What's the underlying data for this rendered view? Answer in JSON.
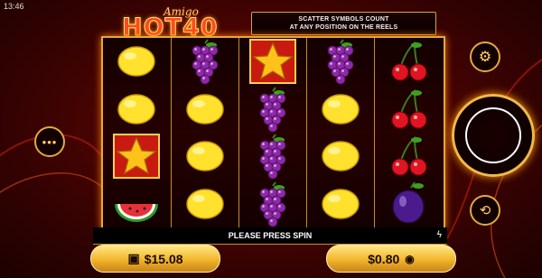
{
  "status": {
    "time": "13:46"
  },
  "logo": {
    "sub": "Amigo",
    "main": "HOT40"
  },
  "banner": {
    "line1": "SCATTER SYMBOLS COUNT",
    "line2": "AT ANY POSITION ON THE REELS"
  },
  "reels": [
    [
      "lemon",
      "lemon",
      "star",
      "watermelon"
    ],
    [
      "grapes",
      "lemon",
      "lemon",
      "lemon"
    ],
    [
      "star",
      "grapes",
      "grapes",
      "grapes"
    ],
    [
      "grapes",
      "lemon",
      "lemon",
      "lemon"
    ],
    [
      "cherries",
      "cherries",
      "cherries",
      "plum"
    ]
  ],
  "message": "PLEASE PRESS SPIN",
  "balance": {
    "value": "$15.08",
    "icon": "wallet-icon"
  },
  "bet": {
    "value": "$0.80",
    "icon": "coins-icon"
  },
  "buttons": {
    "settings_icon": "gear-icon",
    "menu_icon": "more-icon",
    "spin_icon": "spin-icon",
    "autoplay_icon": "autoplay-icon"
  },
  "colors": {
    "gold": "#e3a93c",
    "background": "#3e0302",
    "pill": "#f2b52a"
  }
}
